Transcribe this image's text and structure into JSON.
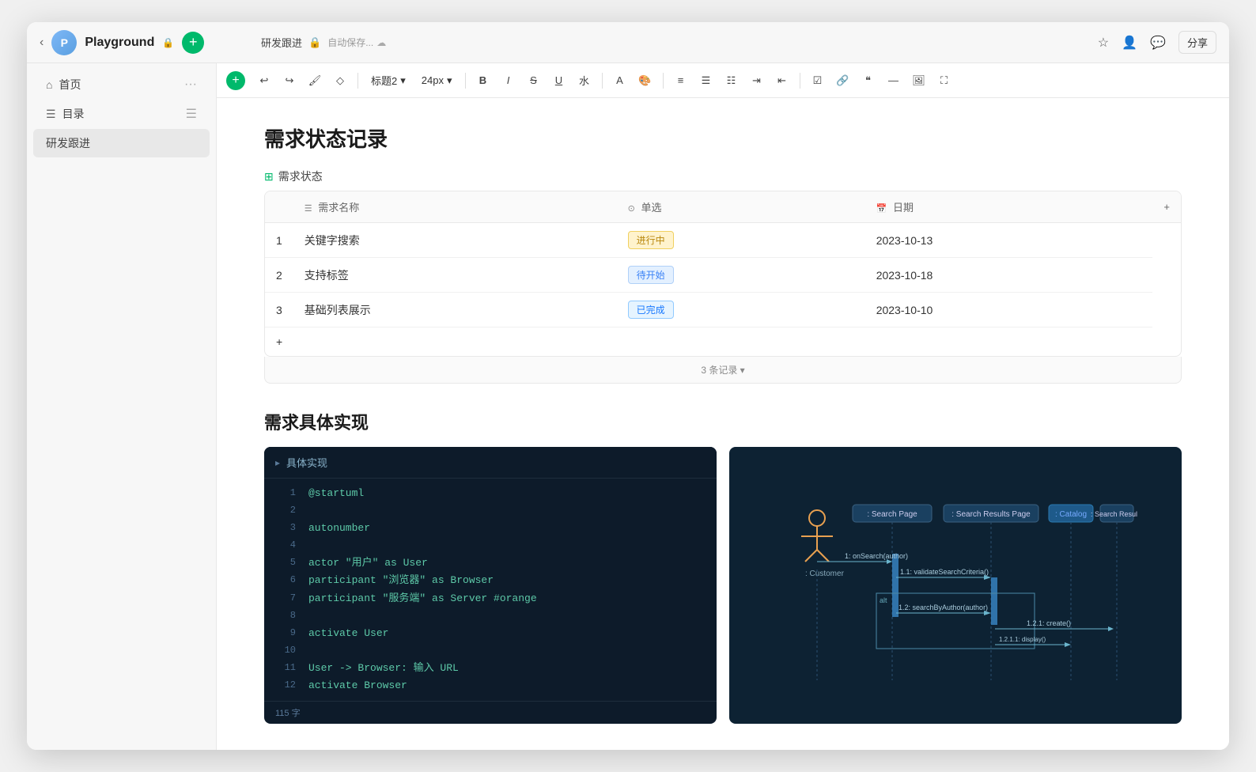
{
  "app": {
    "title": "Playground",
    "lock_icon": "🔒",
    "back_icon": "‹",
    "add_icon": "+",
    "logo_letter": "P"
  },
  "titlebar": {
    "doc_path": "研发跟进",
    "lock": "🔒",
    "auto_save": "自动保存...",
    "cloud": "☁",
    "share": "分享"
  },
  "toolbar": {
    "heading_label": "标题2",
    "heading_arrow": "▾",
    "font_size": "24px",
    "font_size_arrow": "▾",
    "bold": "B",
    "italic": "I",
    "strikethrough": "S",
    "underline": "U",
    "buttons": [
      "⟲",
      "⟳",
      "🖌",
      "◇",
      "B",
      "I",
      "S",
      "U",
      "水",
      "A",
      "🎨"
    ]
  },
  "sidebar": {
    "items": [
      {
        "id": "home",
        "icon": "⌂",
        "label": "首页",
        "dots": "···"
      },
      {
        "id": "toc",
        "icon": "☰",
        "label": "目录",
        "dots": "☰"
      },
      {
        "id": "dev-track",
        "icon": "",
        "label": "研发跟进",
        "active": true
      }
    ]
  },
  "page": {
    "main_title": "需求状态记录",
    "table_section_icon": "⊞",
    "table_section_label": "需求状态",
    "table": {
      "columns": [
        {
          "icon": "☰",
          "label": "需求名称"
        },
        {
          "icon": "⊙",
          "label": "单选"
        },
        {
          "icon": "📅",
          "label": "日期"
        },
        {
          "icon": "+",
          "label": ""
        }
      ],
      "rows": [
        {
          "num": "1",
          "name": "关键字搜索",
          "status": "进行中",
          "status_type": "yellow",
          "date": "2023-10-13"
        },
        {
          "num": "2",
          "name": "支持标签",
          "status": "待开始",
          "status_type": "blue",
          "date": "2023-10-18"
        },
        {
          "num": "3",
          "name": "基础列表展示",
          "status": "已完成",
          "status_type": "green",
          "date": "2023-10-10"
        }
      ],
      "footer": "3 条记录 ▾",
      "add_row": "+"
    },
    "section2_title": "需求具体实现",
    "code_block": {
      "title": "具体实现",
      "char_count": "115 字",
      "lines": [
        {
          "num": "1",
          "content": "@startuml"
        },
        {
          "num": "2",
          "content": ""
        },
        {
          "num": "3",
          "content": "autonumber"
        },
        {
          "num": "4",
          "content": ""
        },
        {
          "num": "5",
          "content": "actor \"用户\" as User"
        },
        {
          "num": "6",
          "content": "participant \"浏览器\" as Browser"
        },
        {
          "num": "7",
          "content": "participant \"服务端\" as Server #orange"
        },
        {
          "num": "8",
          "content": ""
        },
        {
          "num": "9",
          "content": "activate User"
        },
        {
          "num": "10",
          "content": ""
        },
        {
          "num": "11",
          "content": "User -> Browser: 输入 URL"
        },
        {
          "num": "12",
          "content": "activate Browser"
        }
      ]
    }
  }
}
